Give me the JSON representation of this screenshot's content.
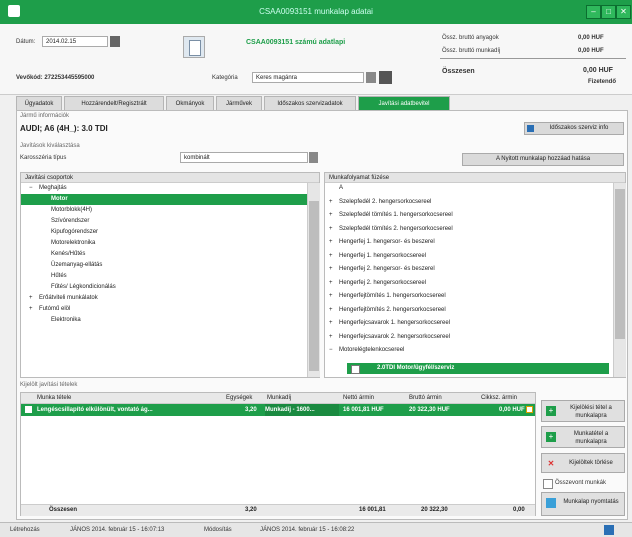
{
  "window": {
    "title": "CSAA0093151 munkalap adatai",
    "min": "–",
    "max": "□",
    "close": "✕"
  },
  "header": {
    "date_label": "Dátum:",
    "date_value": "2014.02.15",
    "calendar_icon": "calendar-icon",
    "worksheet_id": "CSAA0093151 számú adatlapi",
    "customer_label": "Vevőkód: 272253445595000",
    "category_label": "Kategória",
    "category_value": "Keres magánra",
    "totals": [
      {
        "label": "Össz. bruttó anyagok",
        "value": "0,00 HUF"
      },
      {
        "label": "Össz. bruttó munkadíj",
        "value": "0,00 HUF"
      }
    ],
    "total_label": "Összesen",
    "total_value": "0,00 HUF",
    "total_sub": "Fizetendő"
  },
  "tabs": [
    {
      "label": "Ügyadatok",
      "active": false
    },
    {
      "label": "Hozzárendelt/Regisztrált",
      "active": false
    },
    {
      "label": "Okmányok",
      "active": false
    },
    {
      "label": "Járművek",
      "active": false
    },
    {
      "label": "Időszakos szervizadatok",
      "active": false
    },
    {
      "label": "Javítási adatbevitel",
      "active": true
    }
  ],
  "vehicle": {
    "section_label": "Jármű információk",
    "name": "AUDI; A6 (4H_): 3.0 TDI",
    "details_button": "Időszakos szerviz info"
  },
  "repair": {
    "section_label": "Javítások kiválasztása",
    "type_label": "Karosszéria típus",
    "type_value": "kombinált",
    "external_button": "A Nyitott munkalap hozzáad hatása"
  },
  "left_tree": {
    "header": "Javítási csoportok",
    "rows": [
      {
        "text": "Meghajtás",
        "indent": 1,
        "prefix": "−",
        "selected": false
      },
      {
        "text": "Motor",
        "indent": 3,
        "prefix": "",
        "selected": true
      },
      {
        "text": "Motorblokk(4H)",
        "indent": 3,
        "prefix": "",
        "selected": false
      },
      {
        "text": "Szívórendszer",
        "indent": 3,
        "prefix": "",
        "selected": false
      },
      {
        "text": "Kipufogórendszer",
        "indent": 3,
        "prefix": "",
        "selected": false
      },
      {
        "text": "Motorelektronika",
        "indent": 3,
        "prefix": "",
        "selected": false
      },
      {
        "text": "Kenés/Hűtés",
        "indent": 3,
        "prefix": "",
        "selected": false
      },
      {
        "text": "Üzemanyag-ellátás",
        "indent": 3,
        "prefix": "",
        "selected": false
      },
      {
        "text": "Hűtés",
        "indent": 3,
        "prefix": "",
        "selected": false
      },
      {
        "text": "Fűtés/ Légkondicionálás",
        "indent": 3,
        "prefix": "",
        "selected": false
      },
      {
        "text": "Erőátviteli munkálatok",
        "indent": 1,
        "prefix": "+",
        "selected": false
      },
      {
        "text": "Futómű elöl",
        "indent": 1,
        "prefix": "+",
        "selected": false
      },
      {
        "text": "Elektronika",
        "indent": 3,
        "prefix": "",
        "selected": false
      }
    ]
  },
  "right_tree": {
    "header": "Munkafolyamat füzése",
    "rows": [
      {
        "text": "A",
        "prefix": ""
      },
      {
        "text": "Szelepfedél 2. hengersorkocsereel",
        "prefix": "+"
      },
      {
        "text": "Szelepfedél tömítés 1. hengersorkocsereel",
        "prefix": "+"
      },
      {
        "text": "Szelepfedél tömítés 2. hengersorkocsereel",
        "prefix": "+"
      },
      {
        "text": "Hengerfej 1. hengersor- és beszerel",
        "prefix": "+"
      },
      {
        "text": "Hengerfej 1. hengersorkocsereel",
        "prefix": "+"
      },
      {
        "text": "Hengerfej 2. hengersor- és beszerel",
        "prefix": "+"
      },
      {
        "text": "Hengerfej 2. hengersorkocsereel",
        "prefix": "+"
      },
      {
        "text": "Hengerfejtömítés 1. hengersorkocsereel",
        "prefix": "+"
      },
      {
        "text": "Hengerfejtömítés 2. hengersorkocsereel",
        "prefix": "+"
      },
      {
        "text": "Hengerfejcsavarok 1. hengersorkocsereel",
        "prefix": "+"
      },
      {
        "text": "Hengerfejcsavarok 2. hengersorkocsereel",
        "prefix": "+"
      },
      {
        "text": "Motorelégtelenkocsereel",
        "prefix": "−"
      }
    ],
    "selected_row": "2.0TDI Motor/ügyfél/szerviz"
  },
  "selected_items": {
    "section_label": "Kijelölt javítási tételek",
    "columns": [
      "Munka tétele",
      "Egységek",
      "Munkadíj",
      "Nettó ármin",
      "Bruttó ármin",
      "Cikksz. ármin"
    ],
    "rows": [
      {
        "name": "Lengéscsillapító elkülönült, vontató ág...",
        "units": "3,20",
        "labor": "Munkadíj - 1600...",
        "net": "16 001,81 HUF",
        "gross": "20 322,30 HUF",
        "parts": "0,00 HUF"
      }
    ],
    "footer": {
      "label": "Összesen",
      "units": "3,20",
      "net": "16 001,81",
      "gross": "20 322,30",
      "parts": "0,00"
    }
  },
  "side_buttons": [
    {
      "label": "Kijelölési tétel a munkalapra",
      "icon": "plus-icon"
    },
    {
      "label": "Munkatétel a munkalapra",
      "icon": "plus-icon"
    },
    {
      "label": "Kijelöltek törlése",
      "icon": "delete-icon"
    },
    {
      "label": "Összevont munkák",
      "icon": "checkbox-icon"
    },
    {
      "label": "Munkalap nyomtatás",
      "icon": "print-icon"
    }
  ],
  "status_bar": {
    "left": "Létrehozás",
    "created": "JÁNOS 2014. február 15 - 16:07:13",
    "modified_label": "Módosítás",
    "modified": "JÁNOS 2014. február 15 - 16:08:22"
  }
}
